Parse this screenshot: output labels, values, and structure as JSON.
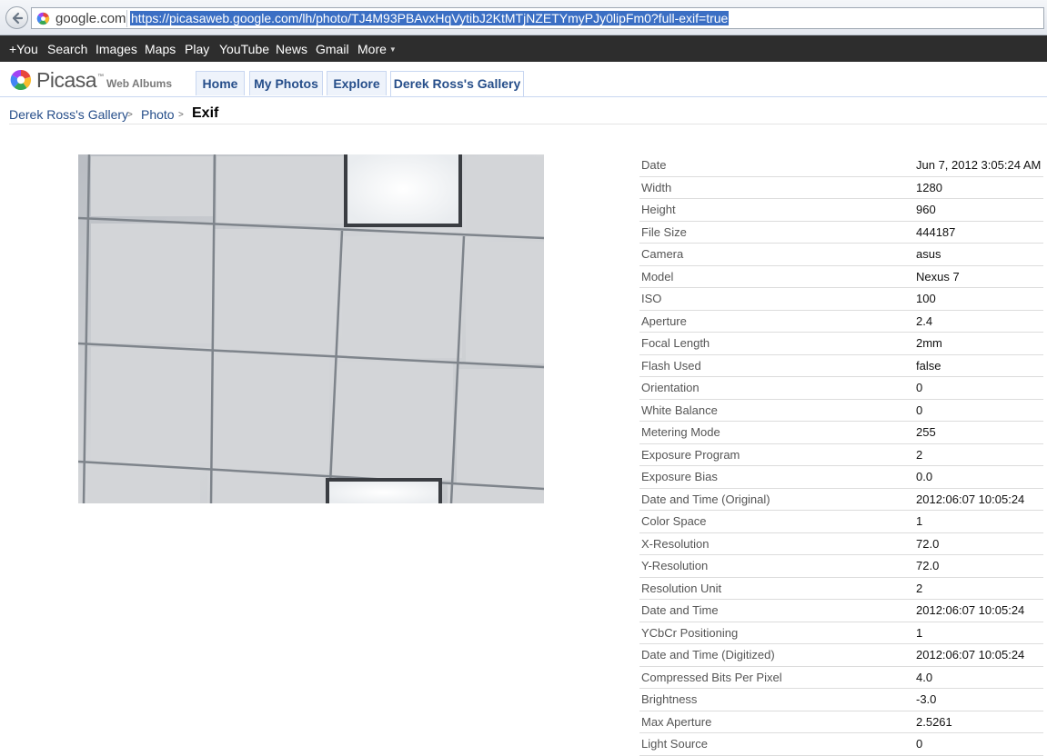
{
  "browser": {
    "domain": "google.com",
    "url": "https://picasaweb.google.com/lh/photo/TJ4M93PBAvxHqVytibJ2KtMTjNZETYmyPJy0lipFm0?full-exif=true"
  },
  "google_bar": {
    "items": [
      "+You",
      "Search",
      "Images",
      "Maps",
      "Play",
      "YouTube",
      "News",
      "Gmail",
      "More"
    ]
  },
  "header": {
    "logo_text": "Picasa",
    "trademark": "™",
    "subtitle": "Web Albums",
    "tabs": [
      {
        "label": "Home",
        "active": false
      },
      {
        "label": "My Photos",
        "active": false
      },
      {
        "label": "Explore",
        "active": false
      },
      {
        "label": "Derek Ross's Gallery",
        "active": true
      }
    ]
  },
  "breadcrumb": {
    "items": [
      "Derek Ross's Gallery",
      "Photo"
    ],
    "separator": ">",
    "current": "Exif"
  },
  "exif": [
    {
      "key": "Date",
      "value": "Jun 7, 2012 3:05:24 AM"
    },
    {
      "key": "Width",
      "value": "1280"
    },
    {
      "key": "Height",
      "value": "960"
    },
    {
      "key": "File Size",
      "value": "444187"
    },
    {
      "key": "Camera",
      "value": "asus"
    },
    {
      "key": "Model",
      "value": "Nexus 7"
    },
    {
      "key": "ISO",
      "value": "100"
    },
    {
      "key": "Aperture",
      "value": "2.4"
    },
    {
      "key": "Focal Length",
      "value": "2mm"
    },
    {
      "key": "Flash Used",
      "value": "false"
    },
    {
      "key": "Orientation",
      "value": "0"
    },
    {
      "key": "White Balance",
      "value": "0"
    },
    {
      "key": "Metering Mode",
      "value": "255"
    },
    {
      "key": "Exposure Program",
      "value": "2"
    },
    {
      "key": "Exposure Bias",
      "value": "0.0"
    },
    {
      "key": "Date and Time (Original)",
      "value": "2012:06:07 10:05:24"
    },
    {
      "key": "Color Space",
      "value": "1"
    },
    {
      "key": "X-Resolution",
      "value": "72.0"
    },
    {
      "key": "Y-Resolution",
      "value": "72.0"
    },
    {
      "key": "Resolution Unit",
      "value": "2"
    },
    {
      "key": "Date and Time",
      "value": "2012:06:07 10:05:24"
    },
    {
      "key": "YCbCr Positioning",
      "value": "1"
    },
    {
      "key": "Date and Time (Digitized)",
      "value": "2012:06:07 10:05:24"
    },
    {
      "key": "Compressed Bits Per Pixel",
      "value": "4.0"
    },
    {
      "key": "Brightness",
      "value": "-3.0"
    },
    {
      "key": "Max Aperture",
      "value": "2.5261"
    },
    {
      "key": "Light Source",
      "value": "0"
    }
  ]
}
